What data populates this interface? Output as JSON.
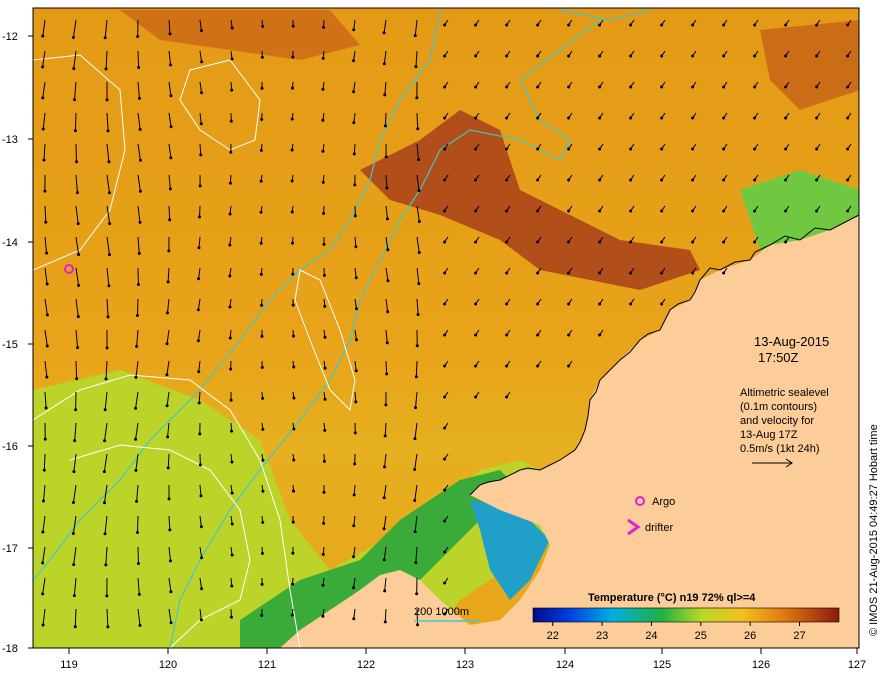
{
  "map": {
    "lat_labels": [
      "-12",
      "-13",
      "-14",
      "-15",
      "-16",
      "-17",
      "-18"
    ],
    "lon_labels": [
      "119",
      "120",
      "121",
      "122",
      "123",
      "124",
      "125",
      "126",
      "127"
    ],
    "lat_range": [
      -18,
      -11.8
    ],
    "lon_range": [
      118.6,
      127
    ]
  },
  "annotations": {
    "date": "13-Aug-2015",
    "time": "17:50Z",
    "altimetry_line1": "Altimetric sealevel",
    "altimetry_line2": "(0.1m contours)",
    "altimetry_line3": "and velocity for",
    "altimetry_line4": "13-Aug 17Z",
    "scale_arrow_label": "0.5m/s (1kt 24h)",
    "argo_label": "Argo",
    "drifter_label": "drifter",
    "isobath_label": "200  1000m",
    "credit": "© IMOS 21-Aug-2015 04:49:27 Hobart time"
  },
  "colorbar": {
    "title": "Temperature (°C) n19 72% ql>=4",
    "ticks": [
      "22",
      "23",
      "24",
      "25",
      "26",
      "27"
    ],
    "min": 21.6,
    "max": 27.8
  },
  "colors": {
    "land": "#fccc99",
    "warm_sst": "#e8a218",
    "hot_sst": "#a83a10",
    "cool_sst": "#c2d82a",
    "cold_sst": "#2fa63a",
    "isobath": "#40c8c8",
    "contour": "#ffffff",
    "marker": "#e020d0"
  }
}
